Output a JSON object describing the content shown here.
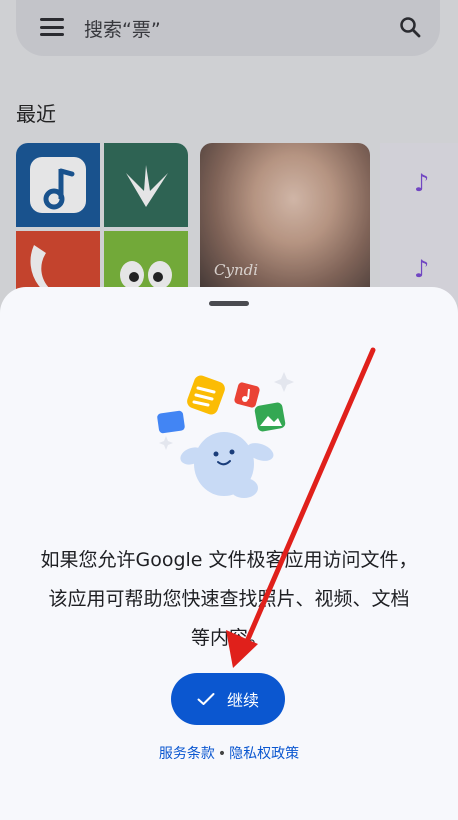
{
  "search": {
    "text": "搜索“票”"
  },
  "recent": {
    "title": "最近"
  },
  "photo": {
    "caption": "Cyndi"
  },
  "sheet": {
    "message": "如果您允许Google 文件极客应用访问文件，该应用可帮助您快速查找照片、视频、文档等内容。",
    "continue_label": "继续",
    "terms_label": "服务条款",
    "separator": "•",
    "privacy_label": "隐私权政策"
  },
  "colors": {
    "primary": "#0b57d0",
    "sheet_bg": "#f7f8fc",
    "arrow": "#e0201b"
  },
  "icons": [
    "menu-icon",
    "search-icon",
    "music-note-icon",
    "check-icon"
  ]
}
